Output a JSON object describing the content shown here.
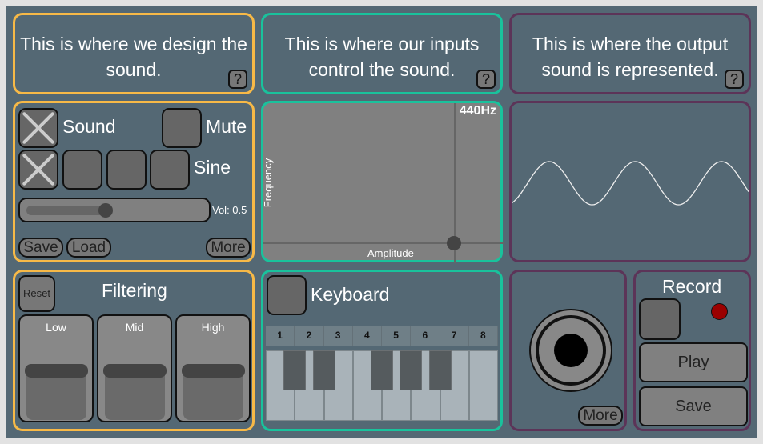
{
  "descriptions": {
    "design": "This is where we design the sound.",
    "inputs": "This is where our inputs control the sound.",
    "output": "This is where the output sound is represented."
  },
  "help_label": "?",
  "sound_panel": {
    "sound_label": "Sound",
    "sound_checked": true,
    "mute_label": "Mute",
    "mute_checked": false,
    "waveform_label": "Sine",
    "waveform_selected": 0,
    "volume_label": "Vol: 0.5",
    "volume": 0.5,
    "save": "Save",
    "load": "Load",
    "more": "More"
  },
  "xy_pad": {
    "freq_readout": "440Hz",
    "x_label": "Amplitude",
    "y_label": "Frequency"
  },
  "filter_panel": {
    "reset": "Reset",
    "title": "Filtering",
    "bands": [
      "Low",
      "Mid",
      "High"
    ]
  },
  "keyboard_panel": {
    "title": "Keyboard",
    "keys": [
      "1",
      "2",
      "3",
      "4",
      "5",
      "6",
      "7",
      "8"
    ]
  },
  "joystick_panel": {
    "more": "More"
  },
  "record_panel": {
    "title": "Record",
    "play": "Play",
    "save": "Save",
    "record_indicator_color": "#9b0000"
  },
  "colors": {
    "design": "#f7b947",
    "input": "#19c29c",
    "output": "#5c3458"
  }
}
